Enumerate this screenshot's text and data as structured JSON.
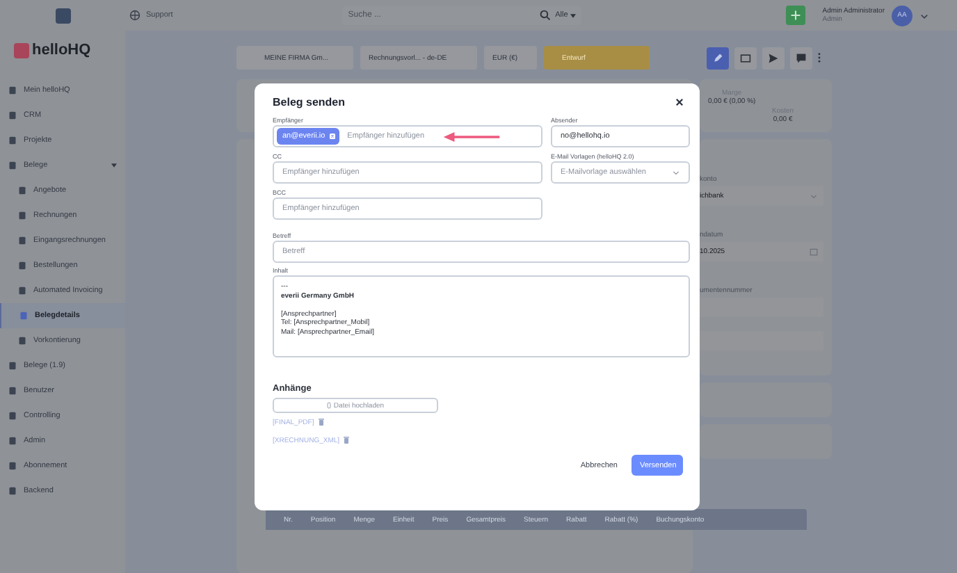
{
  "top_bar": {
    "support_label": "Support",
    "search_placeholder": "Suche ...",
    "search_scope": "Alle",
    "user_name": "Admin Administrator",
    "user_role": "Admin",
    "avatar_initials": "AA"
  },
  "sidebar": {
    "logo_text": "helloHQ",
    "items": [
      {
        "label": "Mein helloHQ",
        "selected": false
      },
      {
        "label": "CRM",
        "selected": false
      },
      {
        "label": "Projekte",
        "selected": false
      },
      {
        "label": "Belege",
        "selected": false,
        "expanded": true,
        "children": [
          {
            "label": "Angebote",
            "selected": false
          },
          {
            "label": "Rechnungen",
            "selected": false
          },
          {
            "label": "Eingangsrechnungen",
            "selected": false
          },
          {
            "label": "Bestellungen",
            "selected": false
          },
          {
            "label": "Automated Invoicing",
            "selected": false
          },
          {
            "label": "Belegdetails",
            "selected": true
          },
          {
            "label": "Vorkontierung",
            "selected": false
          }
        ]
      },
      {
        "label": "Belege (1.9)",
        "selected": false
      },
      {
        "label": "Benutzer",
        "selected": false
      },
      {
        "label": "Controlling",
        "selected": false
      },
      {
        "label": "Admin",
        "selected": false
      },
      {
        "label": "Abonnement",
        "selected": false
      },
      {
        "label": "Backend",
        "selected": false
      }
    ]
  },
  "toolbar": {
    "dropdowns": [
      {
        "value": "MEINE FIRMA Gm..."
      },
      {
        "value": "Rechnungsvorl... - de-DE"
      },
      {
        "value": "EUR (€)"
      }
    ],
    "status": "Entwurf"
  },
  "summary": {
    "margin_label": "Marge",
    "margin_value": "0,00 € (0,00 %)",
    "cost_label": "Kosten",
    "cost_value": "0,00 €"
  },
  "side_form": [
    {
      "label": "konto",
      "value": "ichbank",
      "kind": "select"
    },
    {
      "label": "ndatum",
      "value": "10.2025",
      "kind": "date"
    },
    {
      "label": "umentennummer",
      "kind": "text"
    },
    {
      "kind": "text"
    }
  ],
  "table": {
    "columns": [
      "Nr.",
      "Position",
      "Menge",
      "Einheit",
      "Preis",
      "Gesamtpreis",
      "Steuern",
      "Rabatt",
      "Rabatt (%)",
      "Buchungskonto"
    ]
  },
  "modal": {
    "title": "Beleg senden",
    "recipients": {
      "label": "Empfänger",
      "chips": [
        "an@everii.io"
      ],
      "placeholder": "Empfänger hinzufügen"
    },
    "sender": {
      "label": "Absender",
      "value": "no@hellohq.io"
    },
    "cc": {
      "label": "CC",
      "placeholder": "Empfänger hinzufügen"
    },
    "template": {
      "label": "E-Mail Vorlagen (helloHQ 2.0)",
      "placeholder": "E-Mailvorlage auswählen"
    },
    "bcc": {
      "label": "BCC",
      "placeholder": "Empfänger hinzufügen"
    },
    "subject": {
      "label": "Betreff",
      "placeholder": "Betreff"
    },
    "body": {
      "label": "Inhalt",
      "lines": [
        {
          "text": "---",
          "kind": "plain"
        },
        {
          "text": "everii Germany GmbH",
          "kind": "strong"
        },
        {
          "kind": "blank"
        },
        {
          "text": "[Ansprechpartner]",
          "kind": "plain"
        },
        {
          "text": "Tel: [Ansprechpartner_Mobil]",
          "kind": "plain"
        },
        {
          "text": "Mail: [Ansprechpartner_Email]",
          "kind": "plain"
        }
      ]
    },
    "attachments": {
      "heading": "Anhänge",
      "upload_label": "Datei hochladen",
      "files": [
        "[FINAL_PDF]",
        "[XRECHNUNG_XML]"
      ]
    },
    "buttons": [
      {
        "label": "Abbrechen",
        "kind": "secondary"
      },
      {
        "label": "Versenden",
        "kind": "primary"
      }
    ]
  }
}
